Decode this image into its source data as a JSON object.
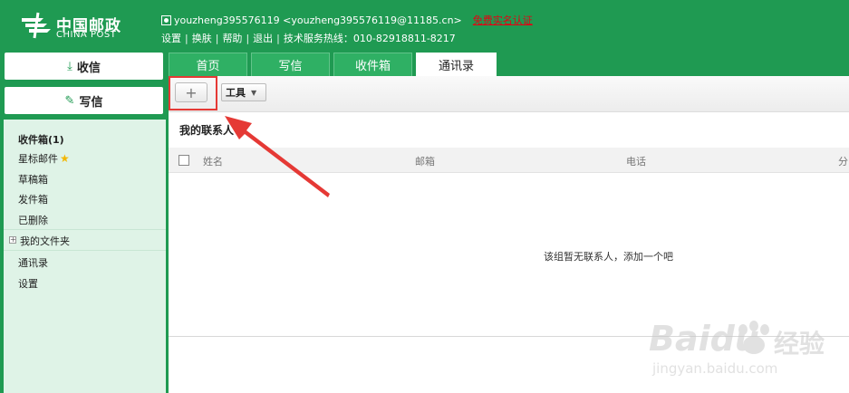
{
  "header": {
    "logo_cn": "中国邮政",
    "logo_en": "CHINA POST",
    "user": "youzheng395576119 <youzheng395576119@11185.cn>",
    "verify_link": "免费实名认证",
    "menu": [
      "设置",
      "换肤",
      "帮助",
      "退出",
      "技术服务热线：010-82918811-8217"
    ]
  },
  "sidebar": {
    "receive_label": "收信",
    "write_label": "写信",
    "folders": {
      "inbox": "收件箱(1)",
      "starred": "星标邮件",
      "drafts": "草稿箱",
      "sent": "发件箱",
      "deleted": "已删除",
      "my_folders": "我的文件夹",
      "contacts": "通讯录",
      "settings": "设置"
    }
  },
  "tabs": [
    "首页",
    "写信",
    "收件箱",
    "通讯录"
  ],
  "toolbar": {
    "add_label": "+",
    "tools_label": "工具"
  },
  "contacts": {
    "group_title": "我的联系人",
    "columns": [
      "姓名",
      "邮箱",
      "电话",
      "分"
    ],
    "empty_message": "该组暂无联系人，添加一个吧"
  },
  "watermark": {
    "brand": "Baidu",
    "brand_cn": "经验",
    "url": "jingyan.baidu.com"
  },
  "colors": {
    "brand_green": "#1f9a52",
    "sidebar_panel": "#dff3e7",
    "annotation_red": "#e53935"
  }
}
